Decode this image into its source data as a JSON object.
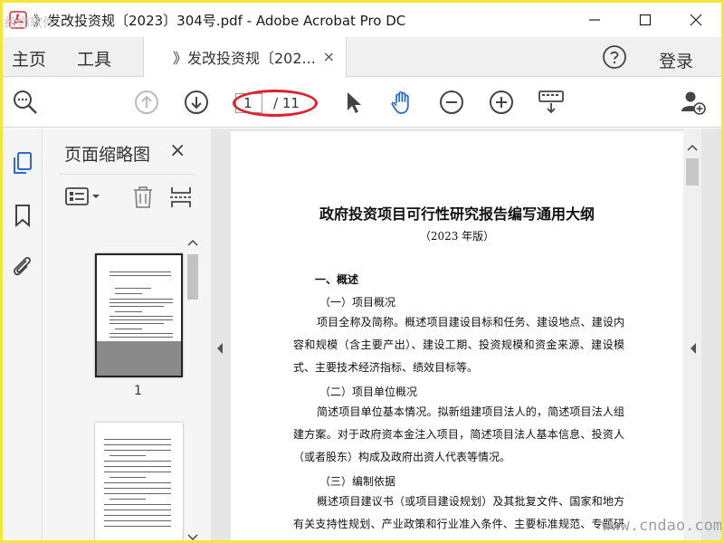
{
  "window": {
    "title": "》发改投资规〔2023〕304号.pdf - Adobe Acrobat Pro DC",
    "watermark_top_left": "给你软件"
  },
  "tabs": {
    "home": "主页",
    "tools": "工具",
    "doc_tab": "》发改投资规〔202...",
    "close": "×",
    "login": "登录"
  },
  "toolbar": {
    "page_current": "1",
    "page_total": "/ 11",
    "highlight_color": "#e0202a"
  },
  "panel": {
    "title": "页面缩略图",
    "close": "×",
    "thumb_labels": [
      "1"
    ]
  },
  "document": {
    "title": "政府投资项目可行性研究报告编写通用大纲",
    "subtitle": "（2023 年版）",
    "h1": "一、概述",
    "h1_1": "（一）项目概况",
    "p1": "项目全称及简称。概述项目建设目标和任务、建设地点、建设内容和规模（含主要产出）、建设工期、投资规模和资金来源、建设模式、主要技术经济指标、绩效目标等。",
    "h1_2": "（二）项目单位概况",
    "p2": "简述项目单位基本情况。拟新组建项目法人的，简述项目法人组建方案。对于政府资本金注入项目，简述项目法人基本信息、投资人（或者股东）构成及政府出资人代表等情况。",
    "h1_3": "（三）编制依据",
    "p3": "概述项目建议书（或项目建设规划）及其批复文件、国家和地方有关支持性规划、产业政策和行业准入条件、主要标准规范、专题研究成果，以及其他依据。"
  },
  "watermark": "www.cndao.com",
  "colors": {
    "accent": "#2b6cd1",
    "frame": "#f5e63c"
  }
}
